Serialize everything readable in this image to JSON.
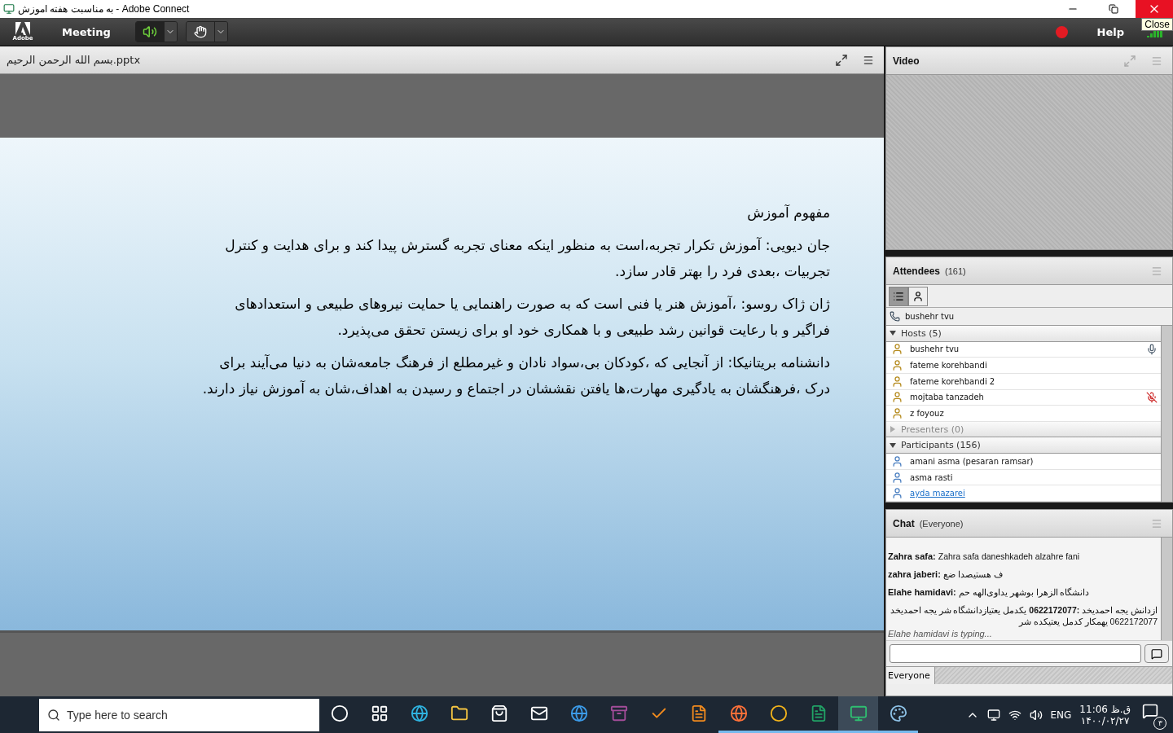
{
  "window": {
    "title": "به مناسبت هفته اموزش - Adobe Connect",
    "tooltip": "Close"
  },
  "menubar": {
    "logo": "Adobe",
    "menu": "Meeting",
    "speaker_on": true,
    "recording": true,
    "help": "Help"
  },
  "share_pod": {
    "title": "بسم الله الرحمن الرحیم.pptx",
    "slide": {
      "heading": "مفهوم آموزش",
      "paragraphs": [
        "جان دیویی: آموزش تکرار تجربه،است به منظور اینکه معنای تجربه گسترش پیدا کند و برای هدایت و کنترل تجربیات ،بعدی فرد را بهتر قادر سازد.",
        "ژان ژاک روسو: ،آموزش هنر یا فنی است که به صورت راهنمایی یا حمایت نیروهای طبیعی و استعدادهای  فراگیر و با رعایت قوانین رشد طبیعی و با همکاری خود او برای زیستن تحقق می‌پذیرد.",
        "دانشنامه بریتانیکا: از آنجایی که ،کودکان بی،سواد نادان و غیرمطلع از فرهنگ جامعه‌شان به دنیا می‌آیند برای درک ،فرهنگشان به یادگیری مهارت،ها یافتن نقششان در اجتماع و رسیدن به اهداف،شان به آموزش نیاز دارند."
      ]
    }
  },
  "video_pod": {
    "title": "Video"
  },
  "attendees_pod": {
    "title": "Attendees",
    "count": "(161)",
    "view_buttons": [
      {
        "kind": "list",
        "selected": true
      },
      {
        "kind": "user",
        "selected": false
      }
    ],
    "caller": "bushehr tvu",
    "groups": [
      {
        "label": "Hosts (5)",
        "expanded": true,
        "items": [
          {
            "name": "bushehr tvu",
            "kind": "host",
            "speaking": true,
            "mic_muted": false,
            "hovered": false
          },
          {
            "name": "fateme korehbandi",
            "kind": "host",
            "speaking": false,
            "mic_muted": false,
            "hovered": false
          },
          {
            "name": "fateme korehbandi 2",
            "kind": "host-mobile",
            "speaking": false,
            "mic_muted": false,
            "hovered": false
          },
          {
            "name": "mojtaba tanzadeh",
            "kind": "host",
            "speaking": false,
            "mic_muted": true,
            "hovered": false
          },
          {
            "name": "z foyouz",
            "kind": "host",
            "speaking": false,
            "mic_muted": false,
            "hovered": false
          }
        ]
      },
      {
        "label": "Presenters (0)",
        "expanded": false
      },
      {
        "label": "Participants (156)",
        "expanded": true,
        "items": [
          {
            "name": "amani asma (pesaran ramsar)",
            "kind": "participant",
            "speaking": false,
            "mic_muted": false,
            "hovered": false
          },
          {
            "name": "asma rasti",
            "kind": "participant",
            "speaking": false,
            "mic_muted": false,
            "hovered": false
          },
          {
            "name": "ayda mazarei",
            "kind": "participant",
            "speaking": false,
            "mic_muted": false,
            "hovered": true
          }
        ]
      }
    ]
  },
  "chat_pod": {
    "title": "Chat",
    "audience": "(Everyone)",
    "messages": [
      {
        "sender": "Zahra safa:",
        "text": "Zahra safa  daneshkadeh alzahre fani"
      },
      {
        "sender": "zahra jaberi:",
        "text": "ف هستیصدا ضع"
      },
      {
        "sender": "Elahe hamidavi:",
        "text": "دانشگاه الزهرا بوشهر یداوی‌الهه حم"
      },
      {
        "text": "ازدانش یجه احمدیخد **:0622172077** یکدمل یعتیازدانشگاه شر یجه احمدیخد 0622172077 یهمکار کدمل یعتیکده شر"
      }
    ],
    "typing": "Elahe hamidavi is typing...",
    "tab": "Everyone"
  },
  "taskbar": {
    "search_placeholder": "Type here to search",
    "apps": [
      {
        "kind": "cortana",
        "running": false,
        "active": false
      },
      {
        "kind": "taskview",
        "running": false,
        "active": false
      },
      {
        "kind": "edge",
        "running": false,
        "active": false
      },
      {
        "kind": "folder",
        "running": false,
        "active": false
      },
      {
        "kind": "store",
        "running": false,
        "active": false
      },
      {
        "kind": "mail",
        "running": false,
        "active": false
      },
      {
        "kind": "ie",
        "running": false,
        "active": false
      },
      {
        "kind": "archive",
        "running": false,
        "active": false
      },
      {
        "kind": "check",
        "running": false,
        "active": false
      },
      {
        "kind": "pdf",
        "running": false,
        "active": false
      },
      {
        "kind": "firefox",
        "running": true,
        "active": false
      },
      {
        "kind": "chrome",
        "running": true,
        "active": false
      },
      {
        "kind": "excel",
        "running": true,
        "active": false
      },
      {
        "kind": "connect",
        "running": true,
        "active": true
      },
      {
        "kind": "paint",
        "running": true,
        "active": false
      }
    ],
    "language": "ENG",
    "time": "11:06 ق.ظ",
    "date": "۱۴۰۰/۰۲/۲۷",
    "notifications": "۳"
  }
}
